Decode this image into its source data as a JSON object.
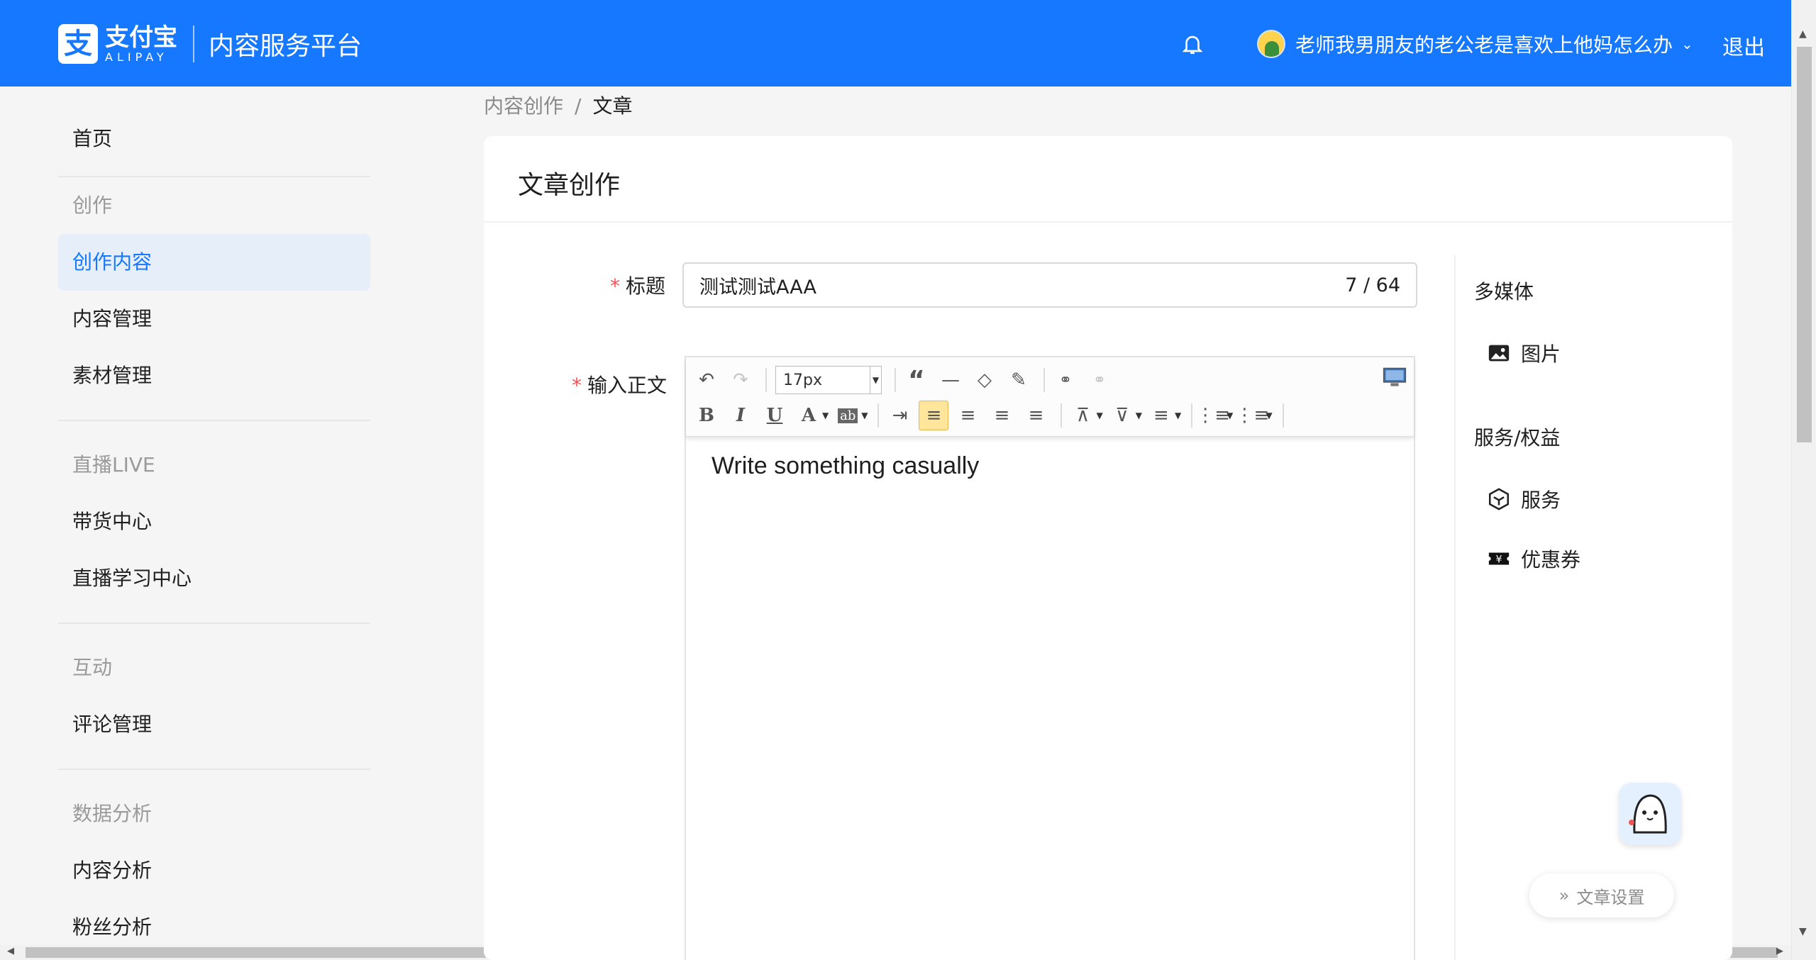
{
  "header": {
    "logo_cn": "支付宝",
    "logo_en": "ALIPAY",
    "platform": "内容服务平台",
    "user_name": "老师我男朋友的老公老是喜欢上他妈怎么办",
    "logout": "退出"
  },
  "sidebar": {
    "home": "首页",
    "groups": [
      {
        "title": "创作",
        "items": [
          "创作内容",
          "内容管理",
          "素材管理"
        ]
      },
      {
        "title": "直播LIVE",
        "items": [
          "带货中心",
          "直播学习中心"
        ]
      },
      {
        "title": "互动",
        "items": [
          "评论管理"
        ]
      },
      {
        "title": "数据分析",
        "items": [
          "内容分析",
          "粉丝分析"
        ]
      }
    ],
    "active_item": "创作内容"
  },
  "breadcrumb": {
    "parent": "内容创作",
    "separator": "/",
    "current": "文章"
  },
  "card": {
    "title": "文章创作"
  },
  "form": {
    "title_label": "标题",
    "title_value": "测试测试AAA",
    "title_count": "7 / 64",
    "body_label": "输入正文",
    "required_mark": "*"
  },
  "editor": {
    "font_size": "17px",
    "content": "Write something casually",
    "toolbar_row1": [
      "undo-icon",
      "redo-icon",
      "font-size-select",
      "quote-icon",
      "horizontal-rule-icon",
      "eraser-icon",
      "format-painter-icon",
      "link-icon",
      "unlink-icon",
      "preview-icon"
    ],
    "toolbar_row2": [
      "bold-icon",
      "italic-icon",
      "underline-icon",
      "font-color-icon",
      "highlight-icon",
      "indent-icon",
      "align-left-icon",
      "align-center-icon",
      "align-right-icon",
      "align-justify-icon",
      "row-spacing-top-icon",
      "row-spacing-bottom-icon",
      "line-height-icon",
      "unordered-list-icon",
      "ordered-list-icon"
    ],
    "glyphs": {
      "bold": "B",
      "italic": "I",
      "underline": "U",
      "font_color": "A",
      "highlight": "ab"
    }
  },
  "right_panel": {
    "media_title": "多媒体",
    "image_label": "图片",
    "service_title": "服务/权益",
    "service_label": "服务",
    "coupon_label": "优惠券",
    "settings_label": "文章设置"
  },
  "colors": {
    "brand": "#1677ff",
    "active_bg": "#e6eef9",
    "required": "#ff4d4f"
  }
}
